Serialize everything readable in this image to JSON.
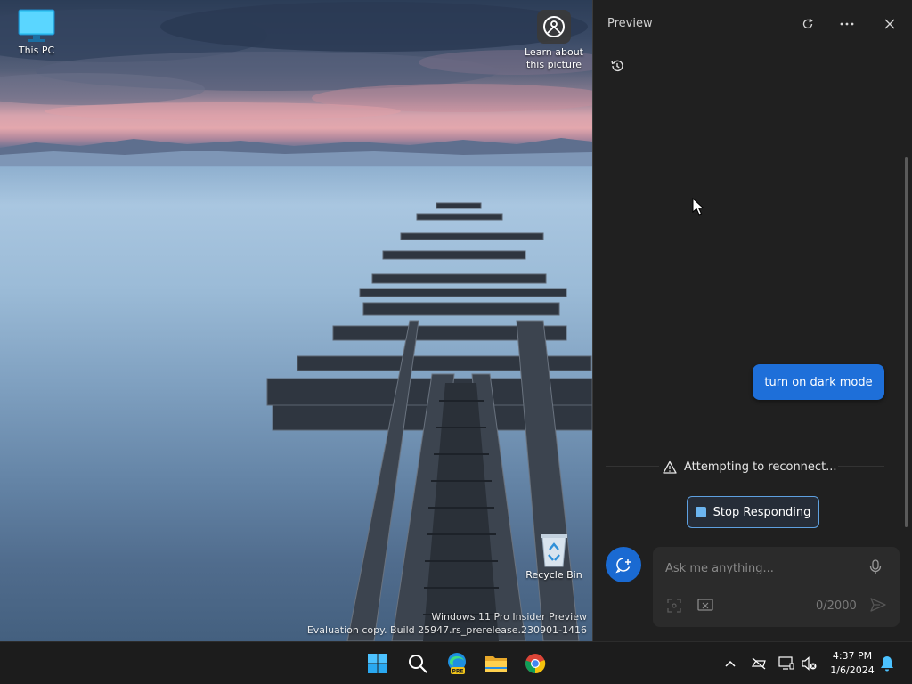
{
  "desktop": {
    "icons": {
      "this_pc": "This PC",
      "learn_line1": "Learn about",
      "learn_line2": "this picture",
      "recycle_bin": "Recycle Bin"
    },
    "watermark": {
      "line1": "Windows 11 Pro Insider Preview",
      "line2": "Evaluation copy. Build 25947.rs_prerelease.230901-1416"
    }
  },
  "pane": {
    "title": "Preview",
    "user_message": "turn on dark mode",
    "status_text": "Attempting to reconnect...",
    "stop_button": "Stop Responding",
    "input_placeholder": "Ask me anything...",
    "char_counter": "0/2000",
    "accent_color": "#1e6fd9"
  },
  "taskbar": {
    "time": "4:37 PM",
    "date": "1/6/2024",
    "icons": [
      "windows-start-icon",
      "search-icon",
      "edge-beta-icon",
      "file-explorer-icon",
      "chrome-icon"
    ],
    "tray": [
      "chevron-up-icon",
      "network-off-icon",
      "display-network-icon",
      "volume-muted-icon",
      "notification-bell-icon"
    ]
  }
}
